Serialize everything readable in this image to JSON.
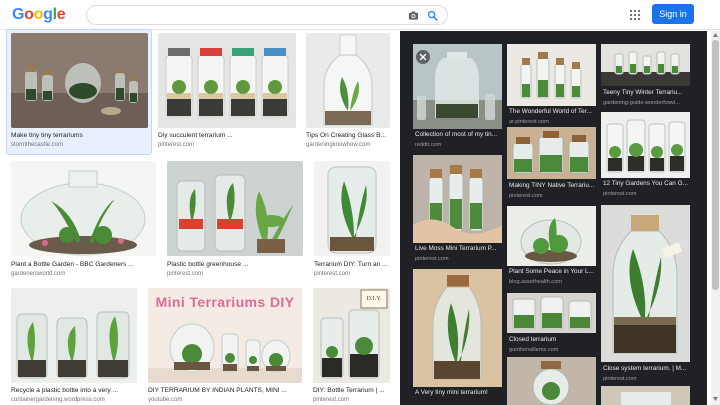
{
  "header": {
    "logo_letters": [
      {
        "ch": "G",
        "color": "#4285f4"
      },
      {
        "ch": "o",
        "color": "#ea4335"
      },
      {
        "ch": "o",
        "color": "#fbbc05"
      },
      {
        "ch": "g",
        "color": "#4285f4"
      },
      {
        "ch": "l",
        "color": "#34a853"
      },
      {
        "ch": "e",
        "color": "#ea4335"
      }
    ],
    "search_value": "",
    "signin_label": "Sign in",
    "accent": "#1a73e8",
    "icons": [
      "camera-icon",
      "search-icon",
      "apps-icon"
    ]
  },
  "results": [
    {
      "title": "Make tiny tiny terrariums",
      "source": "stormthecastle.com"
    },
    {
      "title": "Diy succulent terrarium ...",
      "source": "pinterest.com"
    },
    {
      "title": "Tips On Creating Glass B...",
      "source": "gardeningknowhow.com"
    },
    {
      "title": "Plant a Bottle Garden - BBC Gardeners ...",
      "source": "gardenersworld.com"
    },
    {
      "title": "Plastic bottle greenhouse ...",
      "source": "pinterest.com"
    },
    {
      "title": "Terrarium DIY: Turn an ...",
      "source": "pinterest.com"
    },
    {
      "title": "Recycle a plastic bottle into a very ...",
      "source": "containergardening.wordpress.com"
    },
    {
      "title": "DIY TERRARIUM BY INDIAN PLANTS, MINI ...",
      "source": "youtube.com"
    },
    {
      "title": "DIY: Bottle Terrarium | ...",
      "source": "pinterest.com"
    }
  ],
  "banner_text": "Mini Terrariums DIY",
  "diy_tag": "D.I.Y.",
  "panel": {
    "tiles": [
      {
        "title": "Collection of most of my tin...",
        "source": "reddit.com"
      },
      {
        "title": "The Wonderful World of Ter...",
        "source": "ar.pinterest.com"
      },
      {
        "title": "Teeny Tiny Winter Terrariu...",
        "source": "gardening-guide.wonderhowt..."
      },
      {
        "title": "Making TINY Native Terrariu...",
        "source": "pinterest.com"
      },
      {
        "title": "12 Tiny Gardens You Can G...",
        "source": "pinterest.com"
      },
      {
        "title": "Live Moss Mini Terrarium P...",
        "source": "pinterest.com"
      },
      {
        "title": "Plant Some Peace in Your L...",
        "source": "blog.assethealth.com"
      },
      {
        "title": "Closed terrarium",
        "source": "guntherwillems.com"
      },
      {
        "title": "Close system terrarium. | M...",
        "source": "pinterest.com"
      },
      {
        "title": "A Very tiny mini terrarium!",
        "source": ""
      }
    ]
  }
}
